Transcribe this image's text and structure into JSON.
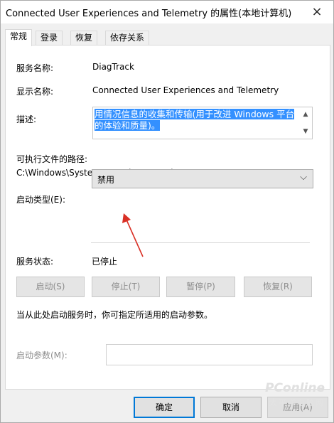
{
  "window": {
    "title": "Connected User Experiences and Telemetry 的属性(本地计算机)",
    "close_icon": "×"
  },
  "tabs": [
    {
      "label": "常规",
      "active": true
    },
    {
      "label": "登录",
      "active": false
    },
    {
      "label": "恢复",
      "active": false
    },
    {
      "label": "依存关系",
      "active": false
    }
  ],
  "general": {
    "service_name_label": "服务名称:",
    "service_name": "DiagTrack",
    "display_name_label": "显示名称:",
    "display_name": "Connected User Experiences and Telemetry",
    "description_label": "描述:",
    "description": "用情况信息的收集和传输(用于改进 Windows 平台的体验和质量)。",
    "exec_path_label": "可执行文件的路径:",
    "exec_path": "C:\\Windows\\System32\\svchost.exe -k utcsvc",
    "startup_type_label": "启动类型(E):",
    "startup_type_value": "禁用",
    "service_status_label": "服务状态:",
    "service_status": "已停止",
    "start_button": "启动(S)",
    "stop_button": "停止(T)",
    "pause_button": "暂停(P)",
    "resume_button": "恢复(R)",
    "hint": "当从此处启动服务时，你可指定所适用的启动参数。",
    "start_params_label": "启动参数(M):",
    "start_params_value": ""
  },
  "footer": {
    "ok_button": "确定",
    "cancel_button": "取消",
    "apply_button": "应用(A)"
  },
  "watermark": {
    "brand": "PConline",
    "sub": "太平洋电脑网"
  },
  "colors": {
    "selection": "#3390ff",
    "focus_border": "#0078d7",
    "annotation_arrow": "#d93025"
  }
}
